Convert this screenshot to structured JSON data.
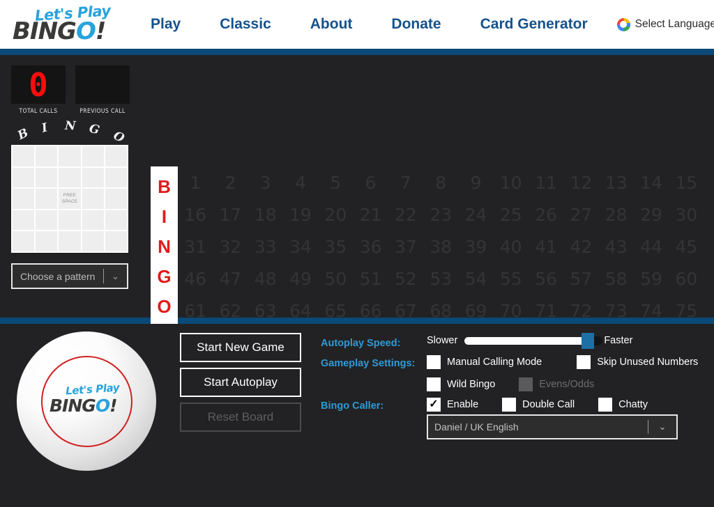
{
  "header": {
    "logo": {
      "top_text": "Let's Play",
      "main_text": "BING",
      "accent_letter": "O",
      "suffix": "!"
    },
    "nav": [
      {
        "label": "Play"
      },
      {
        "label": "Classic"
      },
      {
        "label": "About"
      },
      {
        "label": "Donate"
      },
      {
        "label": "Card Generator"
      }
    ],
    "language": {
      "icon": "google-icon",
      "label": "Select Language",
      "chevron": "⌄"
    }
  },
  "board": {
    "counters": [
      {
        "value": "0",
        "label": "TOTAL CALLS"
      },
      {
        "value": "",
        "label": "PREVIOUS CALL"
      }
    ],
    "pattern_letters": [
      "B",
      "I",
      "N",
      "G",
      "O"
    ],
    "free_space_label": "FREE\nSPACE",
    "free_space_line1": "FREE",
    "free_space_line2": "SPACE",
    "pattern_select": {
      "value": "Choose a pattern",
      "chevron": "⌄"
    },
    "column_letters": [
      "B",
      "I",
      "N",
      "G",
      "O"
    ],
    "rows": [
      [
        1,
        2,
        3,
        4,
        5,
        6,
        7,
        8,
        9,
        10,
        11,
        12,
        13,
        14,
        15
      ],
      [
        16,
        17,
        18,
        19,
        20,
        21,
        22,
        23,
        24,
        25,
        26,
        27,
        28,
        29,
        30
      ],
      [
        31,
        32,
        33,
        34,
        35,
        36,
        37,
        38,
        39,
        40,
        41,
        42,
        43,
        44,
        45
      ],
      [
        46,
        47,
        48,
        49,
        50,
        51,
        52,
        53,
        54,
        55,
        56,
        57,
        58,
        59,
        60
      ],
      [
        61,
        62,
        63,
        64,
        65,
        66,
        67,
        68,
        69,
        70,
        71,
        72,
        73,
        74,
        75
      ]
    ]
  },
  "controls": {
    "ball_logo": {
      "top_text": "Let's Play",
      "main_text": "BING",
      "accent_letter": "O",
      "suffix": "!"
    },
    "buttons": [
      {
        "label": "Start New Game",
        "disabled": false
      },
      {
        "label": "Start Autoplay",
        "disabled": false
      },
      {
        "label": "Reset Board",
        "disabled": true
      }
    ],
    "autoplay": {
      "label": "Autoplay Speed:",
      "min_label": "Slower",
      "max_label": "Faster",
      "value_percent": 88
    },
    "gameplay": {
      "label": "Gameplay Settings:",
      "options": [
        {
          "label": "Manual Calling Mode",
          "checked": false,
          "disabled": false
        },
        {
          "label": "Skip Unused Numbers",
          "checked": false,
          "disabled": false
        },
        {
          "label": "Wild Bingo",
          "checked": false,
          "disabled": false
        },
        {
          "label": "Evens/Odds",
          "checked": false,
          "disabled": true
        }
      ]
    },
    "caller": {
      "label": "Bingo Caller:",
      "options": [
        {
          "label": "Enable",
          "checked": true,
          "disabled": false
        },
        {
          "label": "Double Call",
          "checked": false,
          "disabled": false
        },
        {
          "label": "Chatty",
          "checked": false,
          "disabled": false
        }
      ],
      "voice": {
        "value": "Daniel / UK English",
        "chevron": "⌄"
      }
    }
  },
  "colors": {
    "accent_blue": "#15528c",
    "label_blue": "#2f9ad6",
    "divider_blue": "#0a4a78",
    "red": "#e01b1b",
    "counter_red": "#fb0d0d",
    "background": "#222224"
  }
}
